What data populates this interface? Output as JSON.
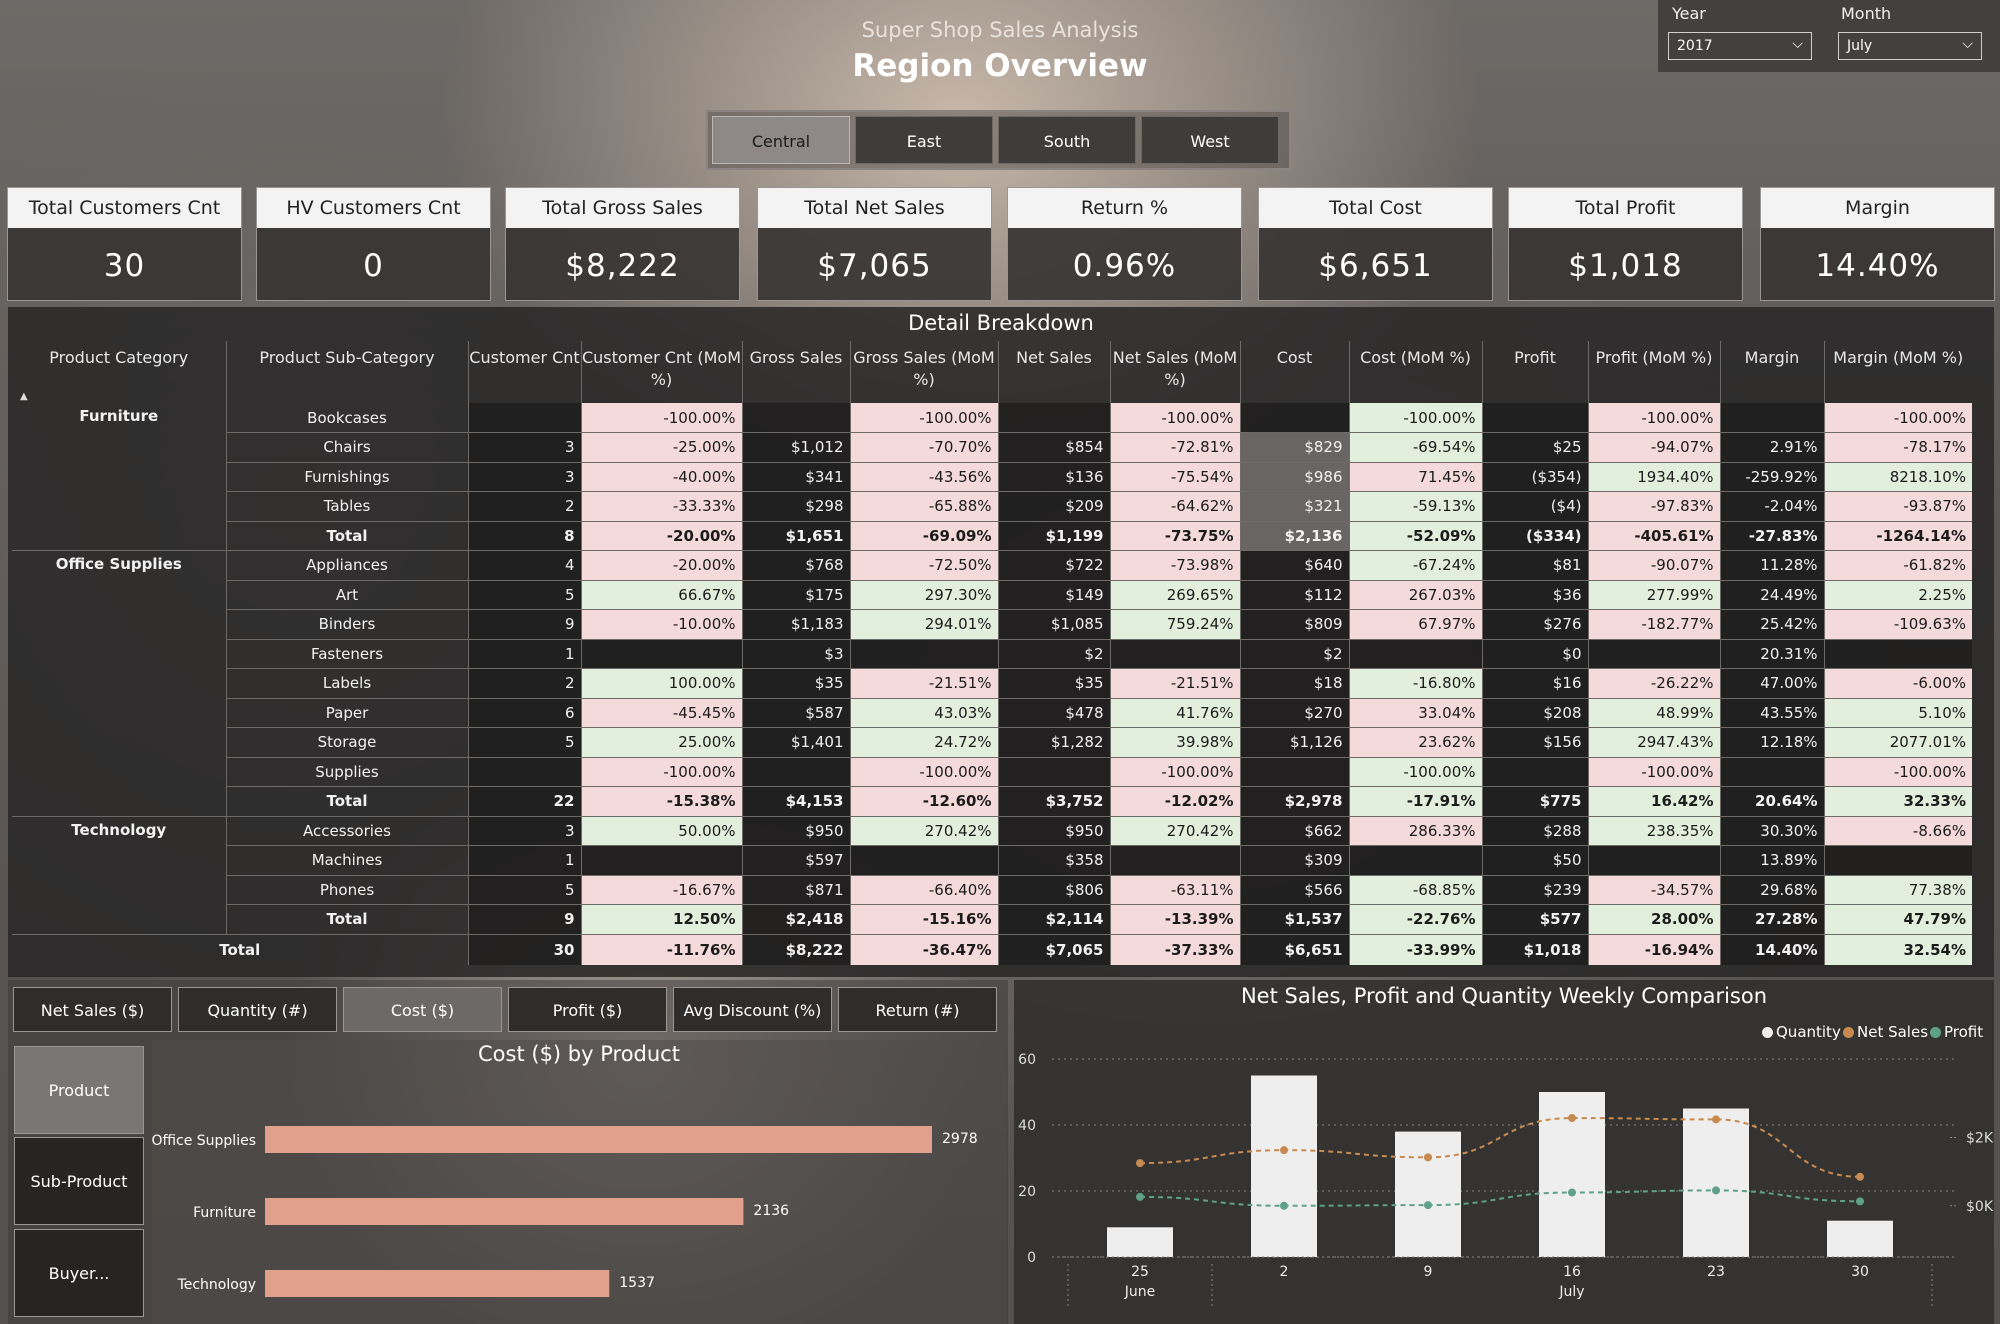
{
  "header": {
    "subtitle": "Super Shop Sales Analysis",
    "title": "Region Overview"
  },
  "filters": {
    "year_label": "Year",
    "year_value": "2017",
    "month_label": "Month",
    "month_value": "July"
  },
  "regions": {
    "items": [
      "Central",
      "East",
      "South",
      "West"
    ],
    "selected": "Central"
  },
  "kpis": [
    {
      "label": "Total Customers Cnt",
      "value": "30"
    },
    {
      "label": "HV Customers Cnt",
      "value": "0"
    },
    {
      "label": "Total Gross Sales",
      "value": "$8,222"
    },
    {
      "label": "Total Net Sales",
      "value": "$7,065"
    },
    {
      "label": "Return %",
      "value": "0.96%"
    },
    {
      "label": "Total Cost",
      "value": "$6,651"
    },
    {
      "label": "Total Profit",
      "value": "$1,018"
    },
    {
      "label": "Margin",
      "value": "14.40%"
    }
  ],
  "matrix": {
    "title": "Detail Breakdown",
    "headers": [
      "Product Category",
      "Product Sub-Category",
      "Customer Cnt",
      "Customer Cnt (MoM %)",
      "Gross Sales",
      "Gross Sales (MoM %)",
      "Net Sales",
      "Net Sales (MoM %)",
      "Cost",
      "Cost (MoM %)",
      "Profit",
      "Profit (MoM %)",
      "Margin",
      "Margin (MoM %)"
    ],
    "groups": [
      {
        "category": "Furniture",
        "rows": [
          {
            "name": "Bookcases",
            "cells": [
              "",
              "-100.00%",
              "",
              "-100.00%",
              "",
              "-100.00%",
              "",
              "-100.00%",
              "",
              "-100.00%",
              "",
              "-100.00%"
            ],
            "colors": [
              "d",
              "p",
              "d",
              "p",
              "d",
              "p",
              "d",
              "g",
              "d",
              "p",
              "d",
              "p"
            ]
          },
          {
            "name": "Chairs",
            "cells": [
              "3",
              "-25.00%",
              "$1,012",
              "-70.70%",
              "$854",
              "-72.81%",
              "$829",
              "-69.54%",
              "$25",
              "-94.07%",
              "2.91%",
              "-78.17%"
            ],
            "colors": [
              "d",
              "p",
              "d",
              "p",
              "d",
              "p",
              "r",
              "g",
              "d",
              "p",
              "d",
              "p"
            ]
          },
          {
            "name": "Furnishings",
            "cells": [
              "3",
              "-40.00%",
              "$341",
              "-43.56%",
              "$136",
              "-75.54%",
              "$986",
              "71.45%",
              "($354)",
              "1934.40%",
              "-259.92%",
              "8218.10%"
            ],
            "colors": [
              "d",
              "p",
              "d",
              "p",
              "d",
              "p",
              "r",
              "p",
              "d",
              "g",
              "d",
              "g"
            ]
          },
          {
            "name": "Tables",
            "cells": [
              "2",
              "-33.33%",
              "$298",
              "-65.88%",
              "$209",
              "-64.62%",
              "$321",
              "-59.13%",
              "($4)",
              "-97.83%",
              "-2.04%",
              "-93.87%"
            ],
            "colors": [
              "d",
              "p",
              "d",
              "p",
              "d",
              "p",
              "r",
              "g",
              "d",
              "p",
              "d",
              "p"
            ]
          },
          {
            "name": "Total",
            "total": true,
            "cells": [
              "8",
              "-20.00%",
              "$1,651",
              "-69.09%",
              "$1,199",
              "-73.75%",
              "$2,136",
              "-52.09%",
              "($334)",
              "-405.61%",
              "-27.83%",
              "-1264.14%"
            ],
            "colors": [
              "d",
              "p",
              "d",
              "p",
              "d",
              "p",
              "r",
              "g",
              "d",
              "p",
              "d",
              "p"
            ]
          }
        ]
      },
      {
        "category": "Office Supplies",
        "rows": [
          {
            "name": "Appliances",
            "cells": [
              "4",
              "-20.00%",
              "$768",
              "-72.50%",
              "$722",
              "-73.98%",
              "$640",
              "-67.24%",
              "$81",
              "-90.07%",
              "11.28%",
              "-61.82%"
            ],
            "colors": [
              "d",
              "p",
              "d",
              "p",
              "d",
              "p",
              "d",
              "g",
              "d",
              "p",
              "d",
              "p"
            ]
          },
          {
            "name": "Art",
            "cells": [
              "5",
              "66.67%",
              "$175",
              "297.30%",
              "$149",
              "269.65%",
              "$112",
              "267.03%",
              "$36",
              "277.99%",
              "24.49%",
              "2.25%"
            ],
            "colors": [
              "d",
              "g",
              "d",
              "g",
              "d",
              "g",
              "d",
              "p",
              "d",
              "g",
              "d",
              "g"
            ]
          },
          {
            "name": "Binders",
            "cells": [
              "9",
              "-10.00%",
              "$1,183",
              "294.01%",
              "$1,085",
              "759.24%",
              "$809",
              "67.97%",
              "$276",
              "-182.77%",
              "25.42%",
              "-109.63%"
            ],
            "colors": [
              "d",
              "p",
              "d",
              "g",
              "d",
              "g",
              "d",
              "p",
              "d",
              "p",
              "d",
              "p"
            ]
          },
          {
            "name": "Fasteners",
            "cells": [
              "1",
              "",
              "$3",
              "",
              "$2",
              "",
              "$2",
              "",
              "$0",
              "",
              "20.31%",
              ""
            ],
            "colors": [
              "d",
              "d",
              "d",
              "d",
              "d",
              "d",
              "d",
              "d",
              "d",
              "d",
              "d",
              "d"
            ]
          },
          {
            "name": "Labels",
            "cells": [
              "2",
              "100.00%",
              "$35",
              "-21.51%",
              "$35",
              "-21.51%",
              "$18",
              "-16.80%",
              "$16",
              "-26.22%",
              "47.00%",
              "-6.00%"
            ],
            "colors": [
              "d",
              "g",
              "d",
              "p",
              "d",
              "p",
              "d",
              "g",
              "d",
              "p",
              "d",
              "p"
            ]
          },
          {
            "name": "Paper",
            "cells": [
              "6",
              "-45.45%",
              "$587",
              "43.03%",
              "$478",
              "41.76%",
              "$270",
              "33.04%",
              "$208",
              "48.99%",
              "43.55%",
              "5.10%"
            ],
            "colors": [
              "d",
              "p",
              "d",
              "g",
              "d",
              "g",
              "d",
              "p",
              "d",
              "g",
              "d",
              "g"
            ]
          },
          {
            "name": "Storage",
            "cells": [
              "5",
              "25.00%",
              "$1,401",
              "24.72%",
              "$1,282",
              "39.98%",
              "$1,126",
              "23.62%",
              "$156",
              "2947.43%",
              "12.18%",
              "2077.01%"
            ],
            "colors": [
              "d",
              "g",
              "d",
              "g",
              "d",
              "g",
              "d",
              "p",
              "d",
              "g",
              "d",
              "g"
            ]
          },
          {
            "name": "Supplies",
            "cells": [
              "",
              "-100.00%",
              "",
              "-100.00%",
              "",
              "-100.00%",
              "",
              "-100.00%",
              "",
              "-100.00%",
              "",
              "-100.00%"
            ],
            "colors": [
              "d",
              "p",
              "d",
              "p",
              "d",
              "p",
              "d",
              "g",
              "d",
              "p",
              "d",
              "p"
            ]
          },
          {
            "name": "Total",
            "total": true,
            "cells": [
              "22",
              "-15.38%",
              "$4,153",
              "-12.60%",
              "$3,752",
              "-12.02%",
              "$2,978",
              "-17.91%",
              "$775",
              "16.42%",
              "20.64%",
              "32.33%"
            ],
            "colors": [
              "d",
              "p",
              "d",
              "p",
              "d",
              "p",
              "d",
              "g",
              "d",
              "g",
              "d",
              "g"
            ]
          }
        ]
      },
      {
        "category": "Technology",
        "rows": [
          {
            "name": "Accessories",
            "cells": [
              "3",
              "50.00%",
              "$950",
              "270.42%",
              "$950",
              "270.42%",
              "$662",
              "286.33%",
              "$288",
              "238.35%",
              "30.30%",
              "-8.66%"
            ],
            "colors": [
              "d",
              "g",
              "d",
              "g",
              "d",
              "g",
              "d",
              "p",
              "d",
              "g",
              "d",
              "p"
            ]
          },
          {
            "name": "Machines",
            "cells": [
              "1",
              "",
              "$597",
              "",
              "$358",
              "",
              "$309",
              "",
              "$50",
              "",
              "13.89%",
              ""
            ],
            "colors": [
              "d",
              "d",
              "d",
              "d",
              "d",
              "d",
              "d",
              "d",
              "d",
              "d",
              "d",
              "d"
            ]
          },
          {
            "name": "Phones",
            "cells": [
              "5",
              "-16.67%",
              "$871",
              "-66.40%",
              "$806",
              "-63.11%",
              "$566",
              "-68.85%",
              "$239",
              "-34.57%",
              "29.68%",
              "77.38%"
            ],
            "colors": [
              "d",
              "p",
              "d",
              "p",
              "d",
              "p",
              "d",
              "g",
              "d",
              "p",
              "d",
              "g"
            ]
          },
          {
            "name": "Total",
            "total": true,
            "cells": [
              "9",
              "12.50%",
              "$2,418",
              "-15.16%",
              "$2,114",
              "-13.39%",
              "$1,537",
              "-22.76%",
              "$577",
              "28.00%",
              "27.28%",
              "47.79%"
            ],
            "colors": [
              "d",
              "g",
              "d",
              "p",
              "d",
              "p",
              "d",
              "g",
              "d",
              "g",
              "d",
              "g"
            ]
          }
        ]
      }
    ],
    "grand_total": {
      "name": "Total",
      "cells": [
        "30",
        "-11.76%",
        "$8,222",
        "-36.47%",
        "$7,065",
        "-37.33%",
        "$6,651",
        "-33.99%",
        "$1,018",
        "-16.94%",
        "14.40%",
        "32.54%"
      ],
      "colors": [
        "d",
        "p",
        "d",
        "p",
        "d",
        "p",
        "d",
        "g",
        "d",
        "p",
        "d",
        "g"
      ]
    }
  },
  "measure_buttons": {
    "items": [
      "Net Sales ($)",
      "Quantity (#)",
      "Cost ($)",
      "Profit ($)",
      "Avg Discount (%)",
      "Return (#)"
    ],
    "selected": "Cost ($)"
  },
  "dimension_buttons": {
    "items": [
      "Product",
      "Sub-Product",
      "Buyer..."
    ],
    "selected": "Product"
  },
  "colors": {
    "bar": "#e0a08c",
    "quantity": "#eeeeee",
    "net_sales": "#c88a4e",
    "profit": "#5fa08a",
    "pink": "#f4dada",
    "green": "#e1efdc"
  },
  "chart_data": [
    {
      "type": "bar",
      "orientation": "horizontal",
      "title": "Cost ($) by Product",
      "categories": [
        "Office Supplies",
        "Furniture",
        "Technology"
      ],
      "values": [
        2978,
        2136,
        1537
      ],
      "data_labels": [
        "2978",
        "2136",
        "1537"
      ],
      "xlim": [
        0,
        3300
      ]
    },
    {
      "type": "bar",
      "title": "Net Sales, Profit and Quantity Weekly Comparison",
      "x": [
        "25",
        "2",
        "9",
        "16",
        "23",
        "30"
      ],
      "x_group_labels": [
        "June",
        "July"
      ],
      "series": [
        {
          "name": "Quantity",
          "type": "bar",
          "axis": "left",
          "values": [
            9,
            55,
            38,
            50,
            45,
            11
          ]
        },
        {
          "name": "Net Sales",
          "type": "line",
          "axis": "right",
          "values": [
            1250,
            1630,
            1420,
            2570,
            2530,
            850
          ]
        },
        {
          "name": "Profit",
          "type": "line",
          "axis": "right",
          "values": [
            260,
            0,
            20,
            390,
            450,
            130
          ]
        }
      ],
      "y_left": {
        "ticks": [
          "0",
          "20",
          "40",
          "60"
        ],
        "range": [
          0,
          60
        ]
      },
      "y_right": {
        "ticks": [
          "$0K",
          "$2K"
        ],
        "range": [
          -1500,
          4300
        ]
      },
      "legend": "top-right",
      "grid": true
    }
  ]
}
